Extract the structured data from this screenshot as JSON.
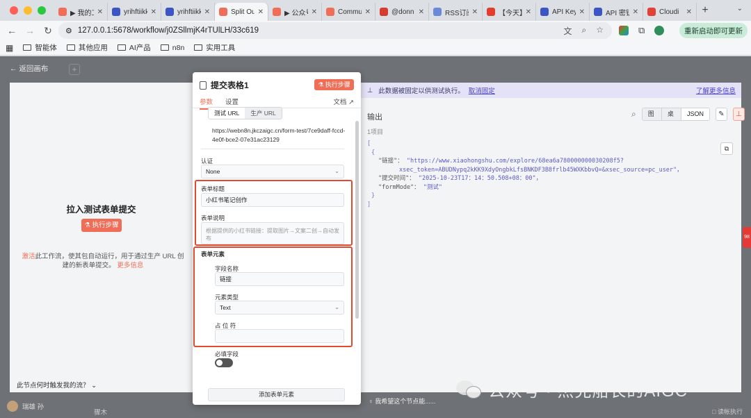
{
  "browser": {
    "tabs": [
      {
        "label": "▶ 我的工",
        "fav_color": "#f06e57",
        "active": false
      },
      {
        "label": "yrihftiikk",
        "fav_color": "#3b55c4",
        "active": false
      },
      {
        "label": "yrihftiikk",
        "fav_color": "#3b55c4",
        "active": false
      },
      {
        "label": "Split Ou",
        "fav_color": "#f06e57",
        "active": true
      },
      {
        "label": "▶ 公众号",
        "fav_color": "#f06e57",
        "active": false
      },
      {
        "label": "Commu",
        "fav_color": "#f06e57",
        "active": false
      },
      {
        "label": "@donn",
        "fav_color": "#d63b2f",
        "active": false
      },
      {
        "label": "RSS订阅",
        "fav_color": "#6a8ad8",
        "active": false
      },
      {
        "label": "【今天】",
        "fav_color": "#e23d2d",
        "active": false
      },
      {
        "label": "API Key",
        "fav_color": "#3b55c4",
        "active": false
      },
      {
        "label": "API 密钥",
        "fav_color": "#3b55c4",
        "active": false
      },
      {
        "label": "Cloudi",
        "fav_color": "#e34133",
        "active": false
      }
    ],
    "url": "127.0.0.1:5678/workflow/j0ZSllmjK4rTUlLH/33c619",
    "relaunch_label": "重新启动即可更新",
    "bookmarks": [
      "智能体",
      "其他应用",
      "AI产品",
      "n8n",
      "实用工具"
    ]
  },
  "canvas": {
    "back_label": "返回画布",
    "left_title": "拉入测试表单提交",
    "left_exec_button": "执行步骤",
    "left_desc_link": "激活",
    "left_desc": "此工作流，使其包自动运行，用于通过生产 URL 创建的新表单提交。",
    "left_desc_more": "更多信息",
    "trigger_question": "此节点何时触发我的流？",
    "user_name": "瑞雄 孙",
    "bottom_hint": "我希望这个节点能......",
    "bottom_tab": "骤木",
    "bottom_right": "□ 读帐执行"
  },
  "output": {
    "pin_text": "此数据被固定以供测试执行。",
    "unpin": "取消固定",
    "learn_more": "了解更多信息",
    "title": "输出",
    "count": "1项目",
    "view_tabs": [
      "图式",
      "桌子",
      "JSON"
    ],
    "active_view": "JSON",
    "json_lines": {
      "open_bracket": "[",
      "open_brace": "{",
      "k1": "\"链接\"：",
      "v1a": "\"https://www.xiaohongshu.com/explore/68ea6a780000000030208f5?",
      "v1b": "xsec_token=ABUDNypq2kKK9XdyOngbkLfsBNKDF3B8frlb45WXKbbvQ=&xsec_source=pc_user\"，",
      "k2": "\"提交时间\"：",
      "v2": "\"2025-10-23T17：14：50.508+08：00\"，",
      "k3": "\"formMode\"：",
      "v3": "\"测试\"",
      "close_brace": "}",
      "close_bracket": "]"
    }
  },
  "modal": {
    "title": "提交表格1",
    "exec_button": "执行步骤",
    "tabs": [
      "参数",
      "设置"
    ],
    "doc_link": "文档",
    "url_tabs": [
      "测试 URL",
      "生产 URL"
    ],
    "webhook_url": "https://webn8n.jkczaigc.cn/form-test/7ce9daff-fccd-4e0f-bce2-07e31ac23129",
    "auth_label": "认证",
    "auth_value": "None",
    "form_title_label": "表单标题",
    "form_title_value": "小红书笔记创作",
    "form_desc_label": "表单说明",
    "form_desc_value": "根据提供的小红书链接：提取图片→文案二创→自动发布",
    "form_elements_label": "表单元素",
    "field_name_label": "字段名称",
    "field_name_value": "链接",
    "element_type_label": "元素类型",
    "element_type_value": "Text",
    "placeholder_label": "占 位 符",
    "placeholder_value": "",
    "required_label": "必填字段",
    "add_element": "添加表单元素"
  },
  "watermark": "公众号 · 杰克船长的AIGC",
  "side_badge": "98",
  "colors": {
    "accent": "#f06e57",
    "highlight_border": "#e04a2f",
    "pin_banner": "#e4e2f6",
    "link": "#4a43c9"
  }
}
